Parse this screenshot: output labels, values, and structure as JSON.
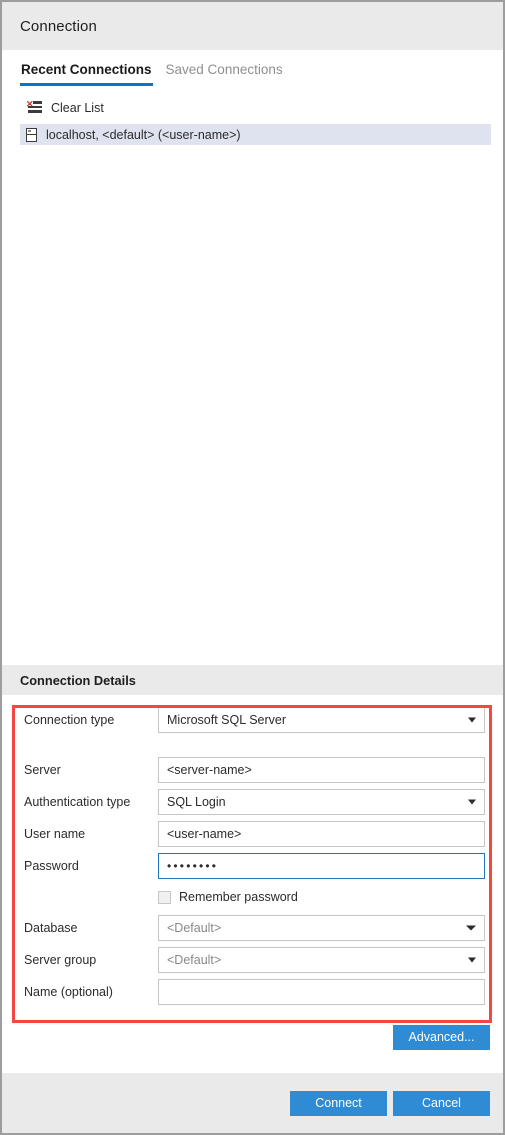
{
  "window": {
    "title": "Connection"
  },
  "tabs": [
    {
      "label": "Recent Connections",
      "active": true
    },
    {
      "label": "Saved Connections",
      "active": false
    }
  ],
  "recent": {
    "clear_list_label": "Clear List",
    "clear_list_icon": "clear-list-icon",
    "items": [
      {
        "label": "localhost, <default> (<user-name>)",
        "icon": "server-icon",
        "selected": true
      }
    ]
  },
  "details": {
    "header": "Connection Details",
    "fields": {
      "connection_type": {
        "label": "Connection type",
        "value": "Microsoft SQL Server",
        "control": "dropdown"
      },
      "server": {
        "label": "Server",
        "value": "<server-name>",
        "control": "textbox"
      },
      "authentication_type": {
        "label": "Authentication type",
        "value": "SQL Login",
        "control": "dropdown"
      },
      "user_name": {
        "label": "User name",
        "value": "<user-name>",
        "control": "textbox"
      },
      "password": {
        "label": "Password",
        "value": "••••••••",
        "control": "password",
        "focused": true
      },
      "remember_password": {
        "label": "Remember password",
        "checked": false,
        "control": "checkbox"
      },
      "database": {
        "label": "Database",
        "value": "<Default>",
        "control": "dropdown",
        "muted": true
      },
      "server_group": {
        "label": "Server group",
        "value": "<Default>",
        "control": "dropdown",
        "muted": true
      },
      "name_optional": {
        "label": "Name (optional)",
        "value": "",
        "control": "textbox"
      }
    }
  },
  "buttons": {
    "advanced": "Advanced...",
    "connect": "Connect",
    "cancel": "Cancel"
  },
  "colors": {
    "accent": "#2e8bd4",
    "tab_underline": "#0a74c8",
    "annotation": "#f4473f",
    "chrome": "#eaeaea",
    "selection": "#dfe3ef",
    "focus_border": "#1f77c4"
  }
}
